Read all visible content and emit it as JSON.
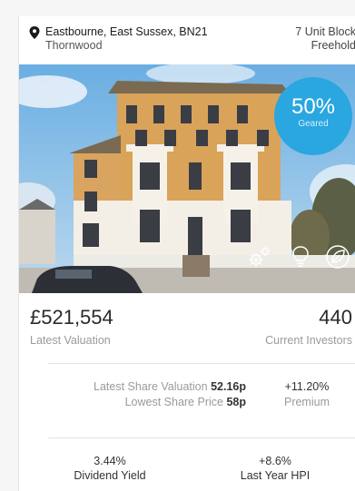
{
  "card": {
    "location": {
      "address": "Eastbourne, East Sussex, BN21",
      "area": "Thornwood"
    },
    "property": {
      "type": "7 Unit Block",
      "tenure": "Freehold"
    },
    "badge": {
      "percent": "50%",
      "label": "Geared"
    },
    "features": [
      "gears-icon",
      "lightbulb-icon",
      "leaf-icon"
    ],
    "valuation": {
      "value": "£521,554",
      "label": "Latest Valuation"
    },
    "investors": {
      "value": "440",
      "label": "Current Investors"
    },
    "share": {
      "valuation_label": "Latest Share Valuation",
      "valuation_value": "52.16p",
      "lowest_label": "Lowest Share Price",
      "lowest_value": "58p"
    },
    "premium": {
      "value": "+11.20%",
      "label": "Premium"
    },
    "dividend": {
      "value": "3.44%",
      "label": "Dividend Yield"
    },
    "hpi": {
      "value": "+8.6%",
      "label": "Last Year HPI"
    }
  },
  "colors": {
    "accent": "#2aa6e0",
    "muted_text": "#9a9a9a"
  }
}
